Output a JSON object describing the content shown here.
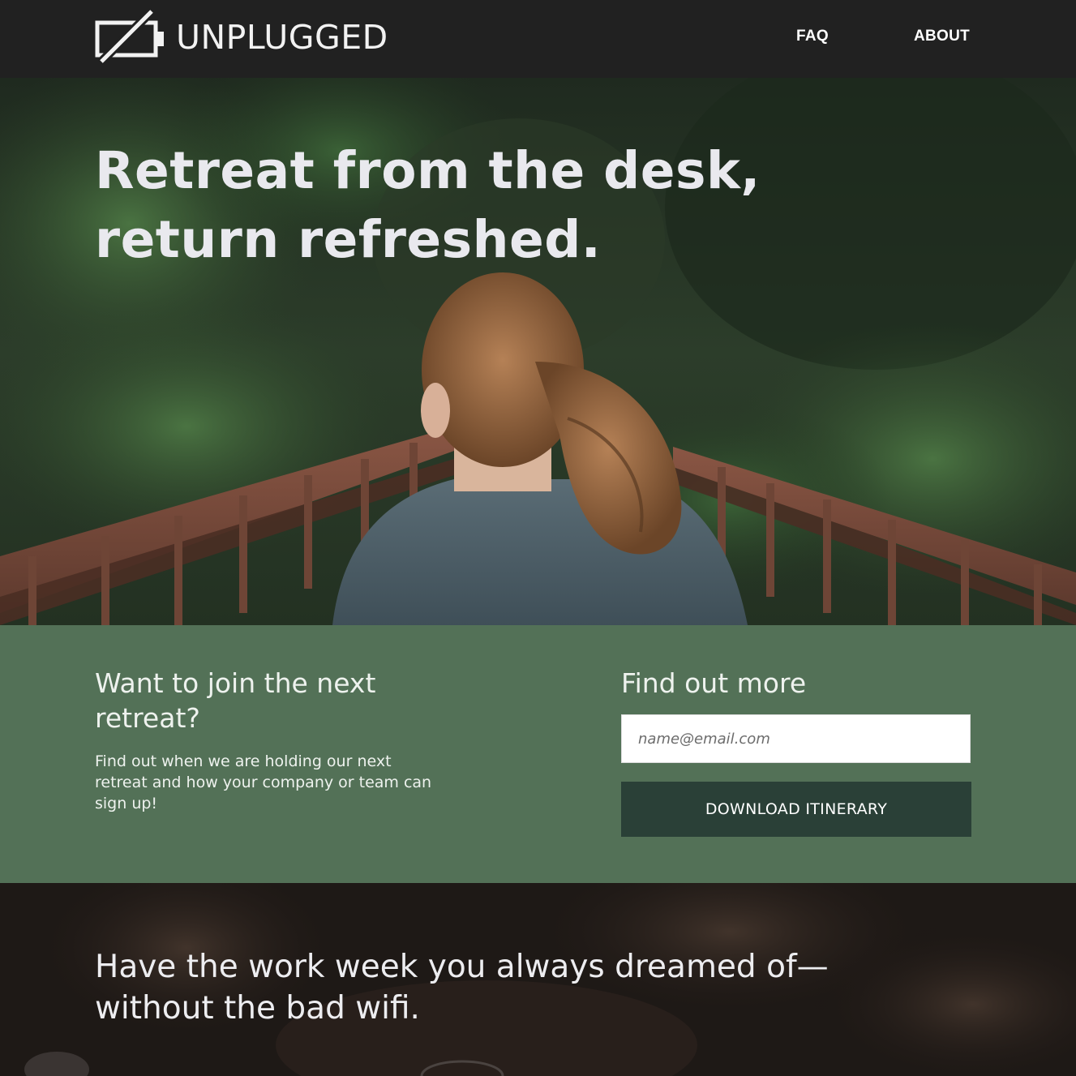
{
  "header": {
    "brand": "UNPLUGGED",
    "logo_icon": "battery-slash-icon",
    "nav": [
      {
        "label": "FAQ"
      },
      {
        "label": "ABOUT"
      }
    ]
  },
  "hero": {
    "title_line1": "Retreat from the desk,",
    "title_line2": "return refreshed."
  },
  "cta": {
    "heading": "Want to join the next retreat?",
    "text": "Find out when we are holding our next retreat and how your company or team can sign up!",
    "form_title": "Find out more",
    "email_placeholder": "name@email.com",
    "button_label": "DOWNLOAD ITINERARY"
  },
  "bottom": {
    "title_line1": "Have the work week you always dreamed of—",
    "title_line2": "without the bad wifi."
  },
  "colors": {
    "header_bg": "#212121",
    "cta_bg": "#537157",
    "button_bg": "#2a4037",
    "text_light": "#eef2ee"
  }
}
